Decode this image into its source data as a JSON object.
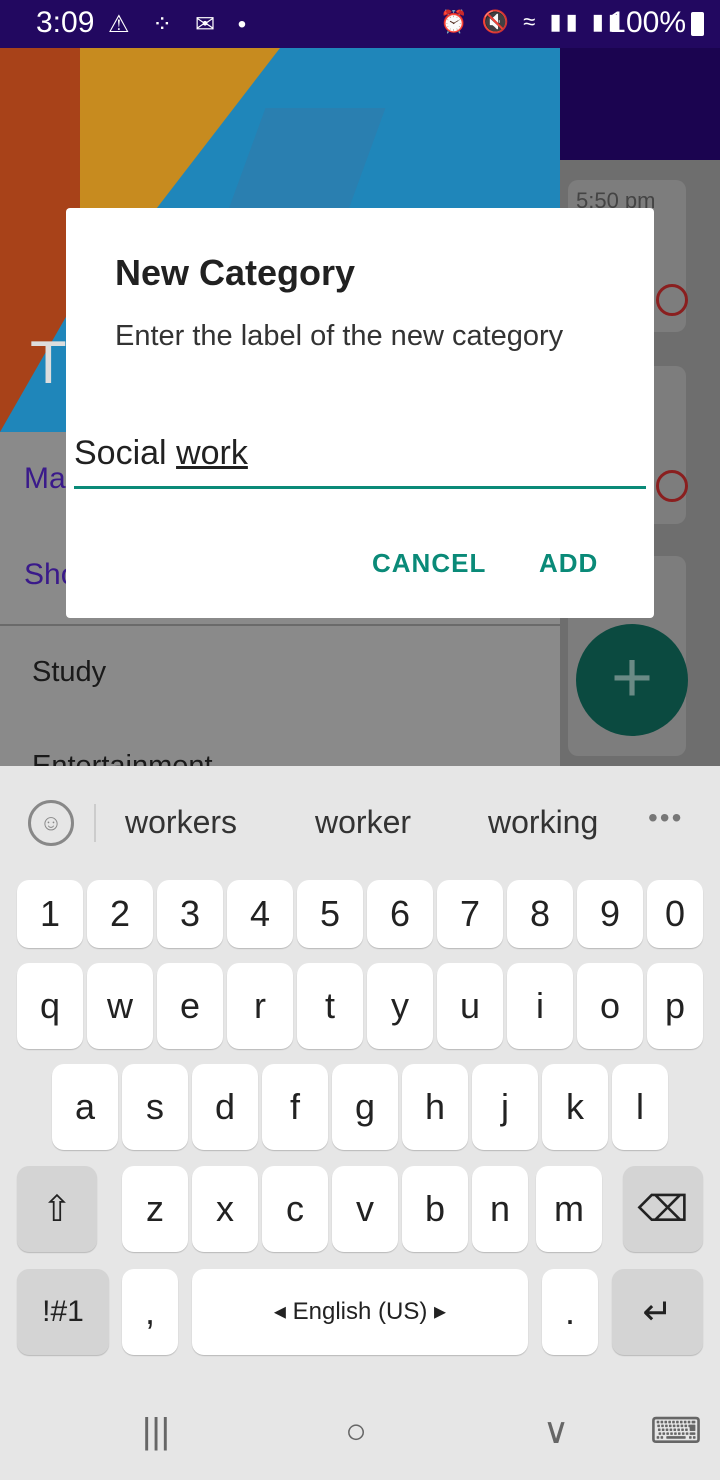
{
  "status_bar": {
    "time": "3:09",
    "left_icons": "⚠ ⁘ ✉ •",
    "right_icons": "⏰ 🔇 ≈ ▮▮ ▮▮",
    "battery_percent": "100%"
  },
  "background": {
    "header_letter": "T",
    "links": [
      "Ma",
      "Sho"
    ],
    "items": [
      "Study",
      "Entertainment"
    ],
    "card_time": "5:50 pm",
    "fab_label": "+"
  },
  "dialog": {
    "title": "New Category",
    "message": "Enter the label of the new category",
    "input_value_prefix": "Social ",
    "input_value_underlined": "work",
    "cancel_label": "CANCEL",
    "add_label": "ADD",
    "accent_color": "#0a8a78"
  },
  "keyboard": {
    "suggestions": [
      "workers",
      "worker",
      "working"
    ],
    "more_label": "•••",
    "number_row": [
      "1",
      "2",
      "3",
      "4",
      "5",
      "6",
      "7",
      "8",
      "9",
      "0"
    ],
    "row1": [
      "q",
      "w",
      "e",
      "r",
      "t",
      "y",
      "u",
      "i",
      "o",
      "p"
    ],
    "row2": [
      "a",
      "s",
      "d",
      "f",
      "g",
      "h",
      "j",
      "k",
      "l"
    ],
    "row3": [
      "z",
      "x",
      "c",
      "v",
      "b",
      "n",
      "m"
    ],
    "shift_label": "⇧",
    "backspace_label": "⌫",
    "symbols_label": "!#1",
    "comma_label": ",",
    "space_label": "◂ English (US) ▸",
    "period_label": ".",
    "enter_label": "↵"
  },
  "nav": {
    "recents_label": "|||",
    "home_label": "○",
    "back_label": "∨",
    "keyboard_label": "⌨"
  }
}
